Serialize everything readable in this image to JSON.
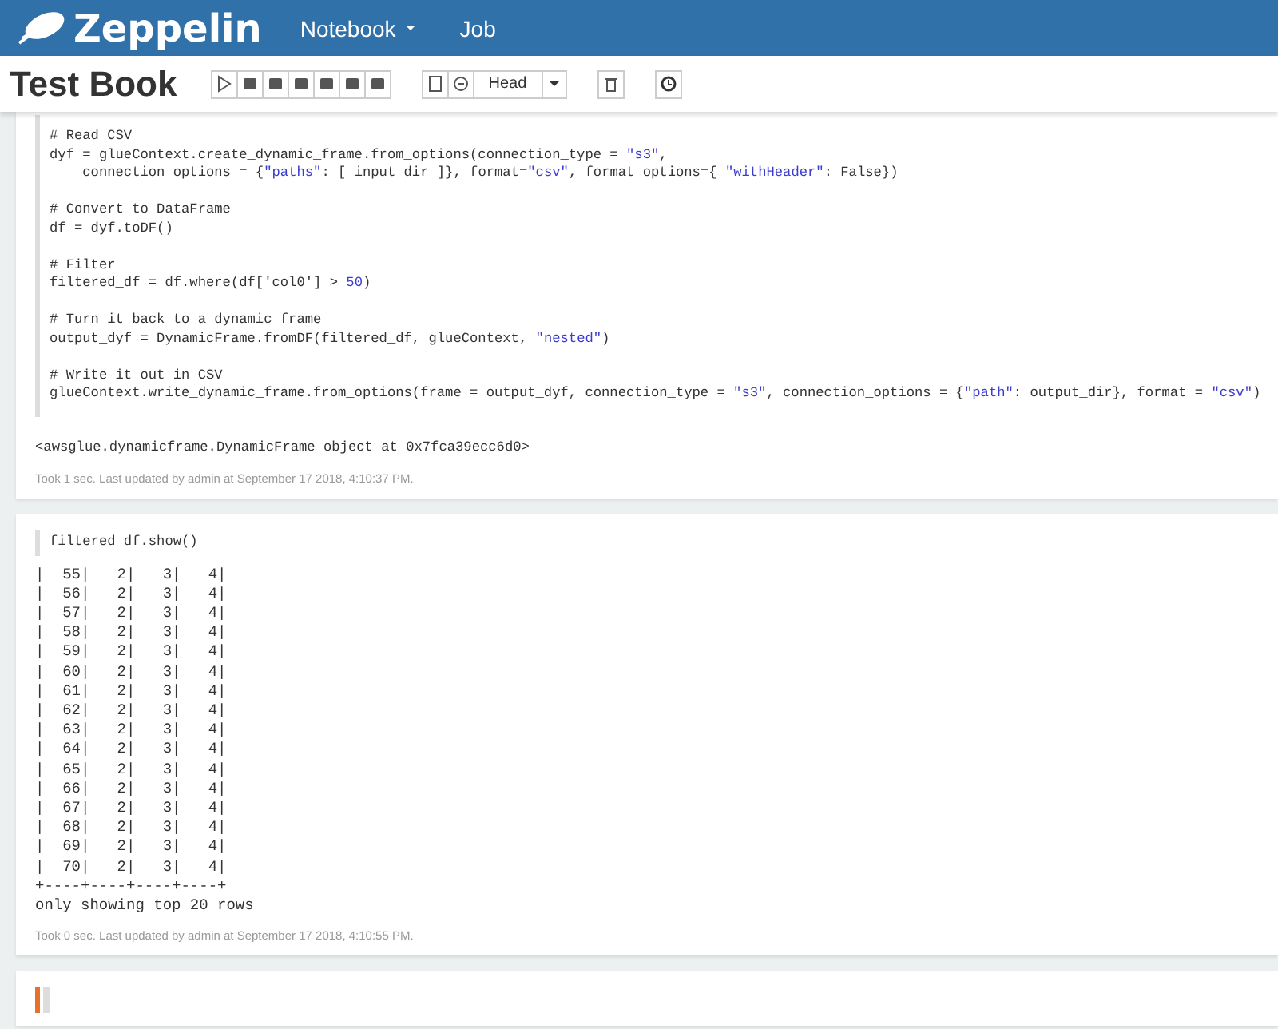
{
  "navbar": {
    "brand": "Zeppelin",
    "items": [
      {
        "label": "Notebook",
        "dropdown": true
      },
      {
        "label": "Job",
        "dropdown": false
      }
    ]
  },
  "notebook": {
    "title": "Test Book",
    "version": "Head"
  },
  "paragraphs": [
    {
      "focused": false,
      "code": [
        [
          [
            {
              "t": "# Read CSV",
              "kind": "plain"
            }
          ],
          [
            {
              "t": "dyf = glueContext.create_dynamic_frame.from_options(connection_type = ",
              "kind": "plain"
            },
            {
              "t": "\"s3\"",
              "kind": "string"
            },
            {
              "t": ",",
              "kind": "plain"
            }
          ],
          [
            {
              "t": "    connection_options = {",
              "kind": "plain"
            },
            {
              "t": "\"paths\"",
              "kind": "string"
            },
            {
              "t": ": [ input_dir ]}, format=",
              "kind": "plain"
            },
            {
              "t": "\"csv\"",
              "kind": "string"
            },
            {
              "t": ", format_options={ ",
              "kind": "plain"
            },
            {
              "t": "\"withHeader\"",
              "kind": "string"
            },
            {
              "t": ": False})",
              "kind": "plain"
            }
          ]
        ],
        [
          [
            {
              "t": "# Convert to DataFrame",
              "kind": "plain"
            }
          ],
          [
            {
              "t": "df = dyf.toDF()",
              "kind": "plain"
            }
          ]
        ],
        [
          [
            {
              "t": "# Filter",
              "kind": "plain"
            }
          ],
          [
            {
              "t": "filtered_df = df.where(df['col0'] > ",
              "kind": "plain"
            },
            {
              "t": "50",
              "kind": "number"
            },
            {
              "t": ")",
              "kind": "plain"
            }
          ]
        ],
        [
          [
            {
              "t": "# Turn it back to a dynamic frame",
              "kind": "plain"
            }
          ],
          [
            {
              "t": "output_dyf = DynamicFrame.fromDF(filtered_df, glueContext, ",
              "kind": "plain"
            },
            {
              "t": "\"nested\"",
              "kind": "string"
            },
            {
              "t": ")",
              "kind": "plain"
            }
          ]
        ],
        [
          [
            {
              "t": "# Write it out in CSV",
              "kind": "plain"
            }
          ],
          [
            {
              "t": "glueContext.write_dynamic_frame.from_options(frame = output_dyf, connection_type = ",
              "kind": "plain"
            },
            {
              "t": "\"s3\"",
              "kind": "string"
            },
            {
              "t": ", connection_options = {",
              "kind": "plain"
            },
            {
              "t": "\"path\"",
              "kind": "string"
            },
            {
              "t": ": output_dir}, format = ",
              "kind": "plain"
            },
            {
              "t": "\"csv\"",
              "kind": "string"
            },
            {
              "t": ")",
              "kind": "plain"
            }
          ]
        ]
      ],
      "output": [
        "<awsglue.dynamicframe.DynamicFrame object at 0x7fca39ecc6d0>"
      ],
      "footer": "Took 1 sec. Last updated by admin at September 17 2018, 4:10:37 PM."
    },
    {
      "focused": false,
      "code": [
        [
          [
            {
              "t": "filtered_df.show()",
              "kind": "plain"
            }
          ]
        ]
      ],
      "output": [
        "|  55|   2|   3|   4|",
        "|  56|   2|   3|   4|",
        "|  57|   2|   3|   4|",
        "|  58|   2|   3|   4|",
        "|  59|   2|   3|   4|",
        "|  60|   2|   3|   4|",
        "|  61|   2|   3|   4|",
        "|  62|   2|   3|   4|",
        "|  63|   2|   3|   4|",
        "|  64|   2|   3|   4|",
        "|  65|   2|   3|   4|",
        "|  66|   2|   3|   4|",
        "|  67|   2|   3|   4|",
        "|  68|   2|   3|   4|",
        "|  69|   2|   3|   4|",
        "|  70|   2|   3|   4|",
        "+----+----+----+----+",
        "only showing top 20 rows"
      ],
      "footer": "Took 0 sec. Last updated by admin at September 17 2018, 4:10:55 PM."
    },
    {
      "focused": true
    }
  ]
}
